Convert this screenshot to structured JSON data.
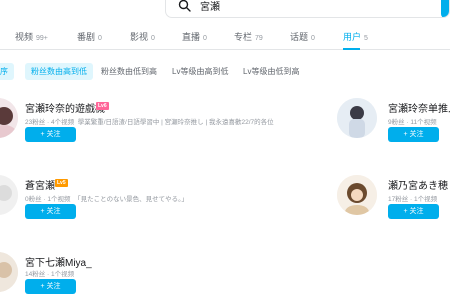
{
  "search": {
    "query": "宮瀬"
  },
  "tabs": [
    {
      "label": "视频",
      "count": "99+"
    },
    {
      "label": "番剧",
      "count": "0"
    },
    {
      "label": "影视",
      "count": "0"
    },
    {
      "label": "直播",
      "count": "0"
    },
    {
      "label": "专栏",
      "count": "79"
    },
    {
      "label": "话题",
      "count": "0"
    },
    {
      "label": "用户",
      "count": "5"
    }
  ],
  "active_tab": "用户",
  "sort_options": [
    {
      "label": "序",
      "active": true
    },
    {
      "label": "粉丝数由高到低",
      "active": true
    },
    {
      "label": "粉丝数由低到高",
      "active": false
    },
    {
      "label": "Lv等级由高到低",
      "active": false
    },
    {
      "label": "Lv等级由低到高",
      "active": false
    }
  ],
  "users": [
    {
      "name": "宮瀬玲奈的遊戲機",
      "level": "Lv6",
      "stats": "23粉丝 · 4个视频",
      "bio": "學業繁重/日語渣/日語學習中 | 宮瀬玲奈推し | 我永遠喜歡22/7的各位",
      "follow_label": "+ 关注"
    },
    {
      "name": "宮瀬玲奈单推人",
      "level": "",
      "stats": "9粉丝 · 11个视频",
      "bio": "",
      "follow_label": "+ 关注"
    },
    {
      "name": "蒼宮瀬",
      "level": "Lv5",
      "stats": "0粉丝 · 1个视频",
      "bio": "「見たことのない景色、見せてやる。」",
      "follow_label": "+ 关注"
    },
    {
      "name": "瀬乃宮あき穂",
      "level": "",
      "stats": "17粉丝 · 1个视频",
      "bio": "",
      "follow_label": "+ 关注"
    },
    {
      "name": "宮下七瀬Miya_",
      "level": "",
      "stats": "14粉丝 · 1个视频",
      "bio": "",
      "follow_label": "+ 关注"
    }
  ],
  "colors": {
    "accent": "#00aeec",
    "level_pink": "#ff6699",
    "level_orange": "#ff9a00"
  }
}
